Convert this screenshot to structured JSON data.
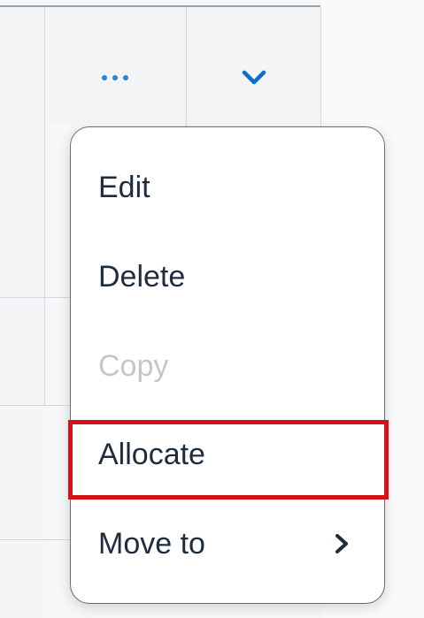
{
  "toolbar": {
    "more_icon": "more-horizontal-icon",
    "expand_icon": "chevron-down-icon",
    "accent_color": "#0a6ed1"
  },
  "menu": {
    "items": [
      {
        "label": "Edit",
        "enabled": true
      },
      {
        "label": "Delete",
        "enabled": true
      },
      {
        "label": "Copy",
        "enabled": false
      },
      {
        "label": "Allocate",
        "enabled": true,
        "highlighted": true
      },
      {
        "label": "Move to",
        "enabled": true,
        "submenu_icon": "chevron-right-icon"
      }
    ],
    "highlight_color": "#d6111a"
  }
}
